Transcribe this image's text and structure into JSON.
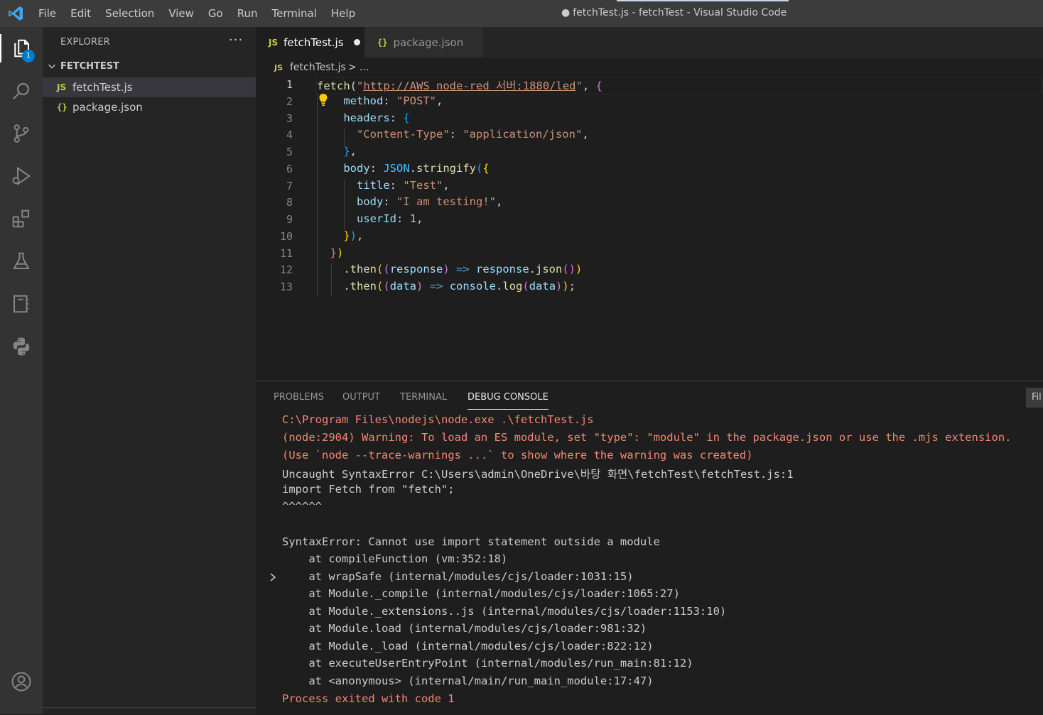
{
  "titlebar": {
    "menu": [
      "File",
      "Edit",
      "Selection",
      "View",
      "Go",
      "Run",
      "Terminal",
      "Help"
    ],
    "dirty_marker": "●",
    "window_title": "fetchTest.js - fetchTest - Visual Studio Code"
  },
  "activitybar": {
    "items": [
      {
        "icon": "explorer-icon",
        "active": true,
        "badge": "1"
      },
      {
        "icon": "search-icon"
      },
      {
        "icon": "source-control-icon"
      },
      {
        "icon": "run-debug-icon"
      },
      {
        "icon": "extensions-icon"
      },
      {
        "icon": "testing-flask-icon"
      },
      {
        "icon": "notebook-icon"
      },
      {
        "icon": "python-icon"
      },
      {
        "icon": "account-icon"
      }
    ]
  },
  "sidebar": {
    "title": "EXPLORER",
    "more": "···",
    "folder": "FETCHTEST",
    "files": [
      {
        "icon_text": "JS",
        "name": "fetchTest.js",
        "selected": true
      },
      {
        "icon_text": "{}",
        "name": "package.json",
        "selected": false
      }
    ]
  },
  "tabs": [
    {
      "icon_text": "JS",
      "label": "fetchTest.js",
      "active": true,
      "dirty": true
    },
    {
      "icon_text": "{}",
      "label": "package.json",
      "active": false
    }
  ],
  "breadcrumb": {
    "icon_text": "JS",
    "file": "fetchTest.js",
    "separator": ">",
    "more": "..."
  },
  "editor": {
    "line_numbers": [
      "1",
      "2",
      "3",
      "4",
      "5",
      "6",
      "7",
      "8",
      "9",
      "10",
      "11",
      "12",
      "13"
    ],
    "lines": {
      "l1": {
        "a": "fetch",
        "b": "(",
        "c": "\"",
        "d": "http://AWS node-red 서버:1880/led",
        "e": "\"",
        "f": ", ",
        "g": "{"
      },
      "l2": {
        "a": "method",
        "b": ": ",
        "c": "\"POST\"",
        "d": ","
      },
      "l3": {
        "a": "headers",
        "b": ": ",
        "c": "{"
      },
      "l4": {
        "a": "\"Content-Type\"",
        "b": ": ",
        "c": "\"application/json\"",
        "d": ","
      },
      "l5": {
        "a": "}",
        "b": ","
      },
      "l6": {
        "a": "body",
        "b": ": ",
        "c": "JSON",
        "d": ".",
        "e": "stringify",
        "f": "(",
        "g": "{"
      },
      "l7": {
        "a": "title",
        "b": ": ",
        "c": "\"Test\"",
        "d": ","
      },
      "l8": {
        "a": "body",
        "b": ": ",
        "c": "\"I am testing!\"",
        "d": ","
      },
      "l9": {
        "a": "userId",
        "b": ": ",
        "c": "1",
        "d": ","
      },
      "l10": {
        "a": "}",
        "b": ")",
        "c": ","
      },
      "l11": {
        "a": "}",
        "b": ")"
      },
      "l12": {
        "a": ".",
        "b": "then",
        "c": "(",
        "d": "(",
        "e": "response",
        "f": ")",
        "g": " => ",
        "h": "response",
        "i": ".",
        "j": "json",
        "k": "(",
        "l": ")",
        "m": ")"
      },
      "l13": {
        "a": ".",
        "b": "then",
        "c": "(",
        "d": "(",
        "e": "data",
        "f": ")",
        "g": " => ",
        "h": "console",
        "i": ".",
        "j": "log",
        "k": "(",
        "l": "data",
        "m": ")",
        "n": ")",
        "o": ";"
      }
    }
  },
  "panel": {
    "tabs": [
      "PROBLEMS",
      "OUTPUT",
      "TERMINAL",
      "DEBUG CONSOLE"
    ],
    "active_tab": "DEBUG CONSOLE",
    "filter_placeholder": "Filter (e.g. text, !exclude)",
    "filter_visible": "Fil",
    "console_lines": [
      {
        "text": "C:\\Program Files\\nodejs\\node.exe .\\fetchTest.js",
        "kind": "err"
      },
      {
        "text": "(node:2904) Warning: To load an ES module, set \"type\": \"module\" in the package.json or use the .mjs extension.",
        "kind": "err"
      },
      {
        "text": "(Use `node --trace-warnings ...` to show where the warning was created)",
        "kind": "err"
      },
      {
        "text": "Uncaught SyntaxError C:\\Users\\admin\\OneDrive\\바탕 화면\\fetchTest\\fetchTest.js:1",
        "kind": "norm"
      },
      {
        "text": "import Fetch from \"fetch\";",
        "kind": "norm"
      },
      {
        "text": "^^^^^^",
        "kind": "norm"
      },
      {
        "text": "SyntaxError: Cannot use import statement outside a module",
        "kind": "norm"
      },
      {
        "text": "    at compileFunction (vm:352:18)",
        "kind": "norm"
      },
      {
        "text": "    at wrapSafe (internal/modules/cjs/loader:1031:15)",
        "kind": "norm"
      },
      {
        "text": "    at Module._compile (internal/modules/cjs/loader:1065:27)",
        "kind": "norm"
      },
      {
        "text": "    at Module._extensions..js (internal/modules/cjs/loader:1153:10)",
        "kind": "norm"
      },
      {
        "text": "    at Module.load (internal/modules/cjs/loader:981:32)",
        "kind": "norm"
      },
      {
        "text": "    at Module._load (internal/modules/cjs/loader:822:12)",
        "kind": "norm"
      },
      {
        "text": "    at executeUserEntryPoint (internal/modules/run_main:81:12)",
        "kind": "norm"
      },
      {
        "text": "    at <anonymous> (internal/main/run_main_module:17:47)",
        "kind": "norm"
      },
      {
        "text": "Process exited with code 1",
        "kind": "err"
      }
    ]
  }
}
